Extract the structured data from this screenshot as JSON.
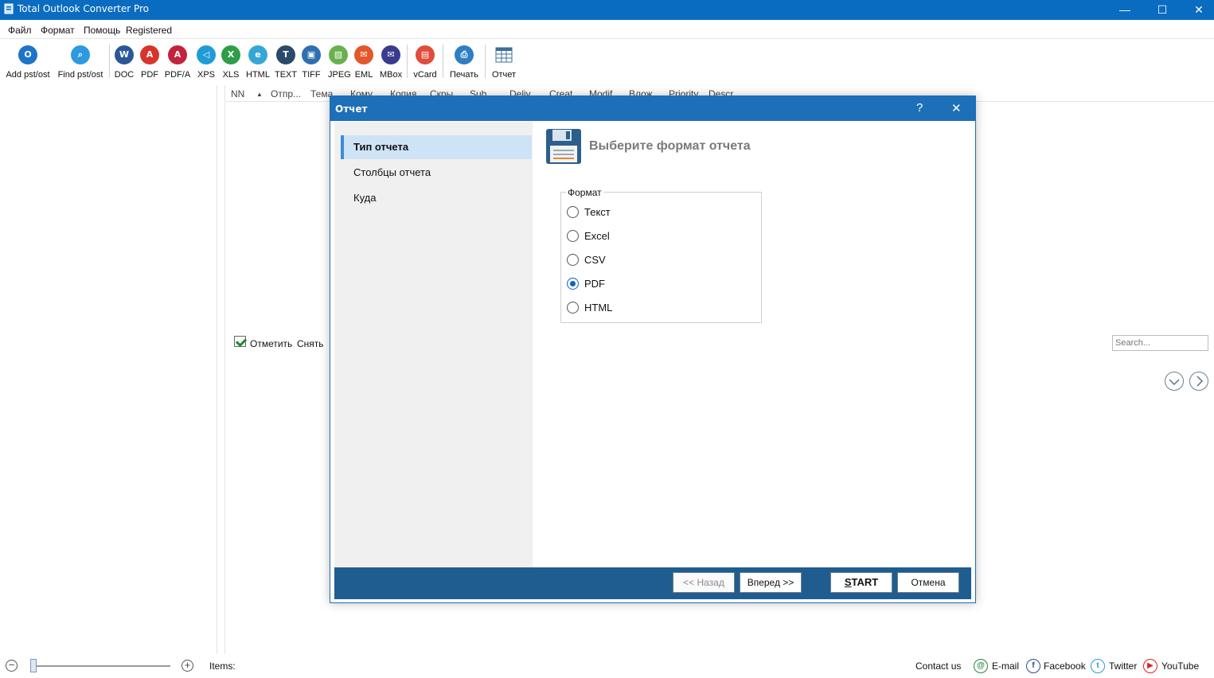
{
  "window": {
    "title": "Total Outlook Converter Pro",
    "minimize": "—",
    "maximize": "☐",
    "close": "✕"
  },
  "menu": [
    "Файл",
    "Формат",
    "Помощь",
    "Registered"
  ],
  "toolbar": [
    {
      "label": "Add pst/ost",
      "icon": "outlook-icon",
      "color": "#1e74c8",
      "glyph": "O"
    },
    {
      "label": "Find pst/ost",
      "icon": "search-icon",
      "color": "#2b9ae0",
      "glyph": "⌕"
    },
    {
      "label": "DOC",
      "icon": "word-icon",
      "color": "#2b5797",
      "glyph": "W"
    },
    {
      "label": "PDF",
      "icon": "pdf-icon",
      "color": "#d9342b",
      "glyph": "A"
    },
    {
      "label": "PDF/A",
      "icon": "pdfa-icon",
      "color": "#c4213e",
      "glyph": "A"
    },
    {
      "label": "XPS",
      "icon": "xps-icon",
      "color": "#1f9bd6",
      "glyph": "◁"
    },
    {
      "label": "XLS",
      "icon": "excel-icon",
      "color": "#2e9e48",
      "glyph": "X"
    },
    {
      "label": "HTML",
      "icon": "html-icon",
      "color": "#35a7d6",
      "glyph": "e"
    },
    {
      "label": "TEXT",
      "icon": "text-icon",
      "color": "#2a4a6a",
      "glyph": "T"
    },
    {
      "label": "TIFF",
      "icon": "tiff-icon",
      "color": "#2f6fb1",
      "glyph": "▣"
    },
    {
      "label": "JPEG",
      "icon": "jpeg-icon",
      "color": "#6ab04c",
      "glyph": "▨"
    },
    {
      "label": "EML",
      "icon": "eml-icon",
      "color": "#e2572b",
      "glyph": "✉"
    },
    {
      "label": "MBox",
      "icon": "mbox-icon",
      "color": "#3b3a8f",
      "glyph": "✉"
    },
    {
      "label": "vCard",
      "icon": "vcard-icon",
      "color": "#e04c3c",
      "glyph": "▤"
    },
    {
      "label": "Печать",
      "icon": "printer-icon",
      "color": "#2f7ec2",
      "glyph": "⎙"
    },
    {
      "label": "Отчет",
      "icon": "report-table-icon",
      "color": "#ffffff",
      "glyph": ""
    }
  ],
  "grid_columns": [
    "NN",
    "Отпр...",
    "Тема",
    "Кому",
    "Копия",
    "Скры...",
    "Sub...",
    "Deliv...",
    "Creat...",
    "Modif...",
    "Влож...",
    "Priority",
    "Descr..."
  ],
  "checkbar": {
    "check_label": "Отметить",
    "uncheck_label": "Снять"
  },
  "search": {
    "placeholder": "Search..."
  },
  "status": {
    "items_label": "Items:",
    "zoom_minus": "−",
    "zoom_plus": "+",
    "zoom_level": 0.02,
    "contact": "Contact us",
    "email": "E-mail",
    "facebook": "Facebook",
    "twitter": "Twitter",
    "youtube": "YouTube"
  },
  "dialog": {
    "title": "Отчет",
    "help": "?",
    "close": "✕",
    "steps": [
      "Тип отчета",
      "Столбцы отчета",
      "Куда"
    ],
    "header": "Выберите формат отчета",
    "group_label": "Формат",
    "options": [
      "Текст",
      "Excel",
      "CSV",
      "PDF",
      "HTML"
    ],
    "selected": "PDF",
    "buttons": {
      "back": "<< Назад",
      "next": "Вперед >>",
      "start": "START",
      "cancel": "Отмена"
    }
  },
  "colors": {
    "titlebar": "#0a6cc0",
    "dialog_accent": "#1d6fb8",
    "footer": "#1f5d91",
    "step_active": "#cfe3f7"
  }
}
